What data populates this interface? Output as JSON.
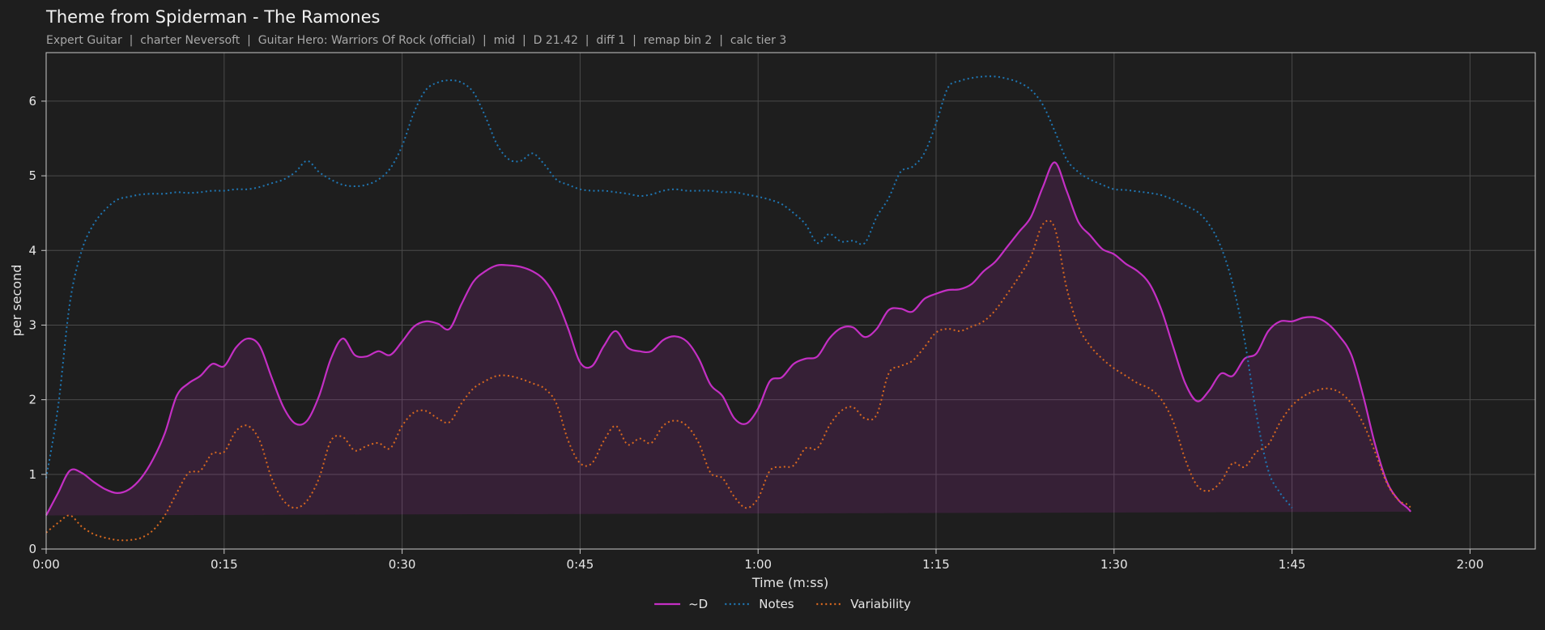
{
  "chart_data": {
    "type": "line",
    "title": "Theme from Spiderman - The Ramones",
    "subtitle": "Expert Guitar  |  charter Neversoft  |  Guitar Hero: Warriors Of Rock (official)  |  mid  |  D 21.42  |  diff 1  |  remap bin 2  |  calc tier 3",
    "xlabel": "Time (m:ss)",
    "ylabel": "per second",
    "xlim": [
      0,
      125.5
    ],
    "ylim": [
      0,
      6.65
    ],
    "x_ticks": [
      {
        "value": 0,
        "label": "0:00"
      },
      {
        "value": 15,
        "label": "0:15"
      },
      {
        "value": 30,
        "label": "0:30"
      },
      {
        "value": 45,
        "label": "0:45"
      },
      {
        "value": 60,
        "label": "1:00"
      },
      {
        "value": 75,
        "label": "1:15"
      },
      {
        "value": 90,
        "label": "1:30"
      },
      {
        "value": 105,
        "label": "1:45"
      },
      {
        "value": 120,
        "label": "2:00"
      }
    ],
    "y_ticks": [
      {
        "value": 0,
        "label": "0"
      },
      {
        "value": 1,
        "label": "1"
      },
      {
        "value": 2,
        "label": "2"
      },
      {
        "value": 3,
        "label": "3"
      },
      {
        "value": 4,
        "label": "4"
      },
      {
        "value": 5,
        "label": "5"
      },
      {
        "value": 6,
        "label": "6"
      }
    ],
    "grid": true,
    "legend_position": "bottom-center",
    "x": [
      0,
      1,
      2,
      3,
      4,
      5,
      6,
      7,
      8,
      9,
      10,
      11,
      12,
      13,
      14,
      15,
      16,
      17,
      18,
      19,
      20,
      21,
      22,
      23,
      24,
      25,
      26,
      27,
      28,
      29,
      30,
      31,
      32,
      33,
      34,
      35,
      36,
      37,
      38,
      39,
      40,
      41,
      42,
      43,
      44,
      45,
      46,
      47,
      48,
      49,
      50,
      51,
      52,
      53,
      54,
      55,
      56,
      57,
      58,
      59,
      60,
      61,
      62,
      63,
      64,
      65,
      66,
      67,
      68,
      69,
      70,
      71,
      72,
      73,
      74,
      75,
      76,
      77,
      78,
      79,
      80,
      81,
      82,
      83,
      84,
      85,
      86,
      87,
      88,
      89,
      90,
      91,
      92,
      93,
      94,
      95,
      96,
      97,
      98,
      99,
      100,
      101,
      102,
      103,
      104,
      105,
      106,
      107,
      108,
      109,
      110,
      111,
      112,
      113,
      114,
      115,
      116,
      117,
      118,
      119,
      120,
      121,
      122,
      123,
      124,
      125.5
    ],
    "series": [
      {
        "name": "~D",
        "color": "#c42fc4",
        "style": "solid",
        "fill": true,
        "values": [
          0.45,
          0.75,
          1.05,
          1.02,
          0.9,
          0.8,
          0.75,
          0.8,
          0.95,
          1.2,
          1.55,
          2.05,
          2.22,
          2.32,
          2.48,
          2.45,
          2.7,
          2.82,
          2.72,
          2.3,
          1.9,
          1.68,
          1.72,
          2.05,
          2.55,
          2.82,
          2.6,
          2.58,
          2.65,
          2.6,
          2.78,
          2.98,
          3.05,
          3.02,
          2.95,
          3.28,
          3.58,
          3.72,
          3.8,
          3.8,
          3.78,
          3.72,
          3.6,
          3.35,
          2.95,
          2.5,
          2.45,
          2.72,
          2.92,
          2.7,
          2.65,
          2.65,
          2.8,
          2.85,
          2.78,
          2.55,
          2.2,
          2.05,
          1.75,
          1.68,
          1.88,
          2.25,
          2.3,
          2.48,
          2.55,
          2.58,
          2.82,
          2.96,
          2.97,
          2.84,
          2.95,
          3.2,
          3.22,
          3.18,
          3.35,
          3.42,
          3.47,
          3.48,
          3.55,
          3.72,
          3.85,
          4.05,
          4.25,
          4.45,
          4.85,
          5.18,
          4.8,
          4.38,
          4.2,
          4.02,
          3.95,
          3.82,
          3.72,
          3.55,
          3.2,
          2.7,
          2.22,
          1.98,
          2.12,
          2.35,
          2.32,
          2.55,
          2.62,
          2.92,
          3.05,
          3.05,
          3.1,
          3.1,
          3.02,
          2.85,
          2.6,
          2.05,
          1.4,
          0.9,
          0.65,
          0.5,
          0.18
        ]
      },
      {
        "name": "Notes",
        "color": "#1f77b4",
        "style": "dotted",
        "fill": false,
        "values": [
          0.95,
          1.9,
          3.3,
          4.0,
          4.35,
          4.55,
          4.68,
          4.72,
          4.75,
          4.76,
          4.76,
          4.78,
          4.77,
          4.78,
          4.8,
          4.8,
          4.82,
          4.82,
          4.85,
          4.9,
          4.95,
          5.05,
          5.2,
          5.05,
          4.95,
          4.88,
          4.86,
          4.88,
          4.95,
          5.1,
          5.4,
          5.85,
          6.15,
          6.25,
          6.28,
          6.25,
          6.12,
          5.8,
          5.42,
          5.22,
          5.2,
          5.3,
          5.15,
          4.95,
          4.88,
          4.82,
          4.8,
          4.8,
          4.78,
          4.76,
          4.73,
          4.75,
          4.8,
          4.82,
          4.8,
          4.8,
          4.8,
          4.78,
          4.78,
          4.75,
          4.72,
          4.68,
          4.62,
          4.5,
          4.35,
          4.1,
          4.22,
          4.12,
          4.13,
          4.1,
          4.45,
          4.7,
          5.05,
          5.12,
          5.3,
          5.7,
          6.18,
          6.27,
          6.31,
          6.33,
          6.33,
          6.3,
          6.25,
          6.15,
          5.95,
          5.6,
          5.22,
          5.05,
          4.95,
          4.88,
          4.82,
          4.81,
          4.79,
          4.77,
          4.74,
          4.68,
          4.6,
          4.52,
          4.35,
          4.05,
          3.55,
          2.8,
          1.8,
          1.05,
          0.75,
          0.55,
          0.3
        ]
      },
      {
        "name": "Variability",
        "color": "#d9691f",
        "style": "dotted",
        "fill": false,
        "values": [
          0.22,
          0.35,
          0.45,
          0.3,
          0.2,
          0.15,
          0.12,
          0.12,
          0.15,
          0.25,
          0.45,
          0.75,
          1.02,
          1.05,
          1.28,
          1.3,
          1.58,
          1.65,
          1.45,
          0.95,
          0.65,
          0.55,
          0.65,
          0.95,
          1.45,
          1.5,
          1.32,
          1.38,
          1.42,
          1.35,
          1.65,
          1.83,
          1.85,
          1.75,
          1.7,
          1.95,
          2.15,
          2.25,
          2.32,
          2.32,
          2.28,
          2.22,
          2.15,
          1.95,
          1.45,
          1.15,
          1.15,
          1.45,
          1.65,
          1.4,
          1.48,
          1.42,
          1.65,
          1.72,
          1.65,
          1.42,
          1.02,
          0.95,
          0.7,
          0.55,
          0.68,
          1.05,
          1.1,
          1.12,
          1.35,
          1.35,
          1.65,
          1.85,
          1.9,
          1.75,
          1.8,
          2.35,
          2.45,
          2.52,
          2.7,
          2.9,
          2.95,
          2.92,
          2.98,
          3.05,
          3.2,
          3.42,
          3.65,
          3.92,
          4.35,
          4.3,
          3.5,
          2.98,
          2.72,
          2.55,
          2.42,
          2.32,
          2.22,
          2.15,
          2.0,
          1.7,
          1.2,
          0.85,
          0.78,
          0.9,
          1.15,
          1.1,
          1.3,
          1.4,
          1.7,
          1.92,
          2.05,
          2.12,
          2.15,
          2.1,
          1.95,
          1.68,
          1.3,
          0.88,
          0.65,
          0.55,
          0.15
        ]
      }
    ]
  }
}
